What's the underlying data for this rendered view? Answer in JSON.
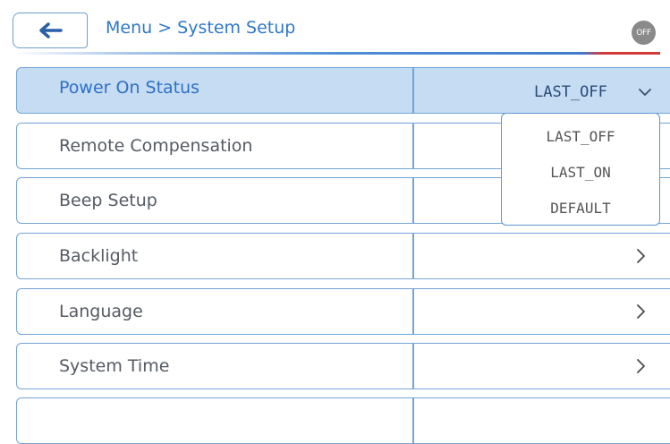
{
  "header": {
    "breadcrumb": "Menu > System Setup",
    "power_badge": "OFF"
  },
  "rows": [
    {
      "label": "Power On Status",
      "value": "LAST_OFF"
    },
    {
      "label": "Remote Compensation"
    },
    {
      "label": "Beep Setup"
    },
    {
      "label": "Backlight"
    },
    {
      "label": "Language"
    },
    {
      "label": "System Time"
    }
  ],
  "dropdown": {
    "options": [
      "LAST_OFF",
      "LAST_ON",
      "DEFAULT"
    ]
  },
  "colors": {
    "accent": "#2f78c9",
    "active_row": "#c5dcf3",
    "border": "#72a4d8"
  }
}
